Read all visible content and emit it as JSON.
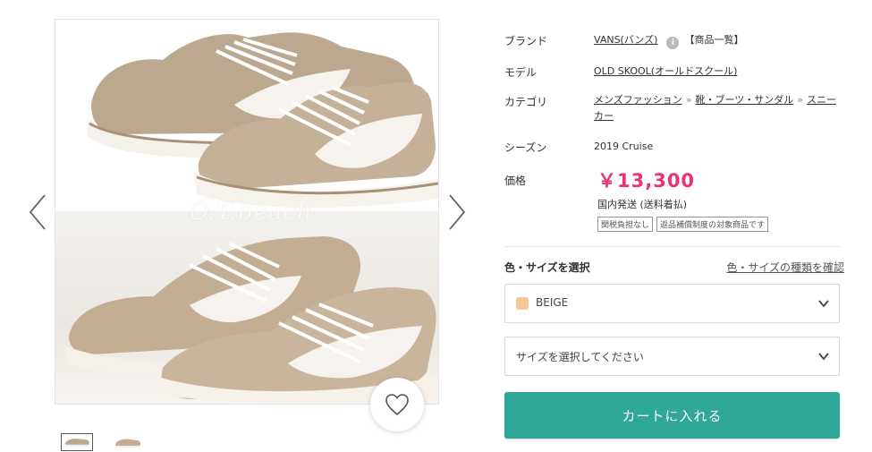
{
  "gallery": {
    "watermark": "O.T.beach",
    "thumbnail_count": 2
  },
  "product": {
    "brand_label": "ブランド",
    "brand_link": "VANS(バンズ)",
    "brand_list_link": "【商品一覧】",
    "model_label": "モデル",
    "model_link": "OLD SKOOL(オールドスクール)",
    "category_label": "カテゴリ",
    "category_1": "メンズファッション",
    "category_sep_1": "»",
    "category_2": "靴・ブーツ・サンダル",
    "category_sep_2": "»",
    "category_3": "スニーカー",
    "season_label": "シーズン",
    "season_value": "2019 Cruise",
    "price_label": "価格",
    "price": "￥13,300",
    "shipping": "国内発送 (送料着払)",
    "badges": [
      "関税負担なし",
      "返品補償制度の対象商品です"
    ]
  },
  "selection": {
    "title": "色・サイズを選択",
    "size_guide": "色・サイズの種類を確認",
    "color_value": "BEIGE",
    "color_swatch": "#f7c89a",
    "size_placeholder": "サイズを選択してください"
  },
  "cart": {
    "label": "カートに入れる",
    "color": "#2fa897"
  },
  "icons": {
    "info": "i"
  }
}
